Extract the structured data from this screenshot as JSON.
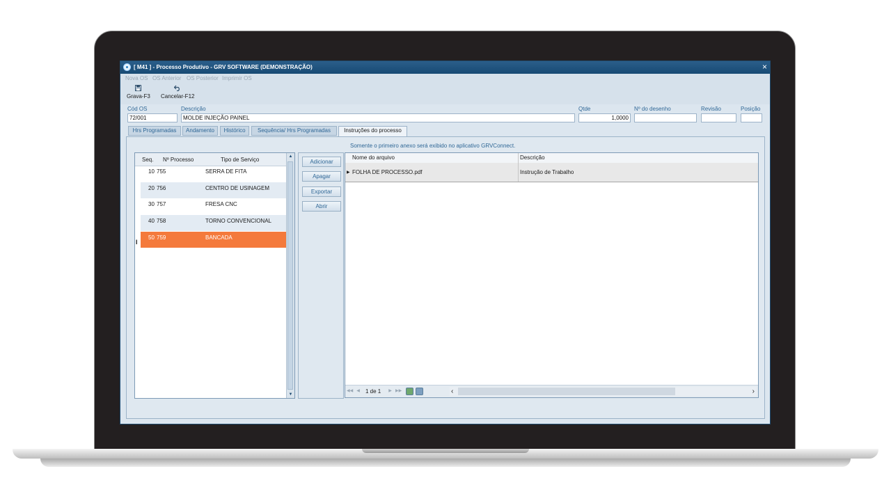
{
  "window": {
    "title": "[ M41 ] - Processo Produtivo - GRV SOFTWARE (DEMONSTRAÇÃO)",
    "close": "×"
  },
  "menu": [
    "Nova OS",
    "OS Anterior",
    "OS Posterior",
    "Imprimir OS"
  ],
  "toolbar": {
    "save": {
      "label": "Grava-F3",
      "icon": "floppy-disk-icon"
    },
    "cancel": {
      "label": "Cancelar-F12",
      "icon": "undo-arrow-icon"
    }
  },
  "form": {
    "cod_os": {
      "label": "Cód OS",
      "value": "72/001"
    },
    "descricao": {
      "label": "Descrição",
      "value": "MOLDE INJEÇÃO PAINEL"
    },
    "qtde": {
      "label": "Qtde",
      "value": "1,0000"
    },
    "desenho": {
      "label": "Nº do desenho",
      "value": ""
    },
    "revisao": {
      "label": "Revisão",
      "value": ""
    },
    "posicao": {
      "label": "Posição",
      "value": ""
    }
  },
  "tabs": [
    "Hrs Programadas",
    "Andamento",
    "Histórico",
    "Sequência/ Hrs Programadas",
    "Instruções do processo"
  ],
  "active_tab": "Instruções do processo",
  "process_grid": {
    "headers": {
      "seq": "Seq.",
      "processo": "Nº Processo",
      "servico": "Tipo de Serviço"
    },
    "rows": [
      {
        "seq": "10",
        "processo": "755",
        "servico": "SERRA DE FITA"
      },
      {
        "seq": "20",
        "processo": "756",
        "servico": "CENTRO DE USINAGEM"
      },
      {
        "seq": "30",
        "processo": "757",
        "servico": "FRESA CNC"
      },
      {
        "seq": "40",
        "processo": "758",
        "servico": "TORNO CONVENCIONAL"
      },
      {
        "seq": "50",
        "processo": "759",
        "servico": "BANCADA"
      }
    ],
    "selected_row_index": 4,
    "row_indicator": "I",
    "selection_color": "#f47a3c"
  },
  "actions": [
    "Adicionar",
    "Apagar",
    "Exportar",
    "Abrir"
  ],
  "note": "Somente o primeiro anexo será exibido no aplicativo GRVConnect.",
  "attachments": {
    "headers": {
      "arquivo": "Nome do arquivo",
      "descricao": "Descrição"
    },
    "rows": [
      {
        "arquivo": "FOLHA DE PROCESSO.pdf",
        "descricao": "Instrução de Trabalho"
      }
    ],
    "pager": "1 de 1"
  }
}
